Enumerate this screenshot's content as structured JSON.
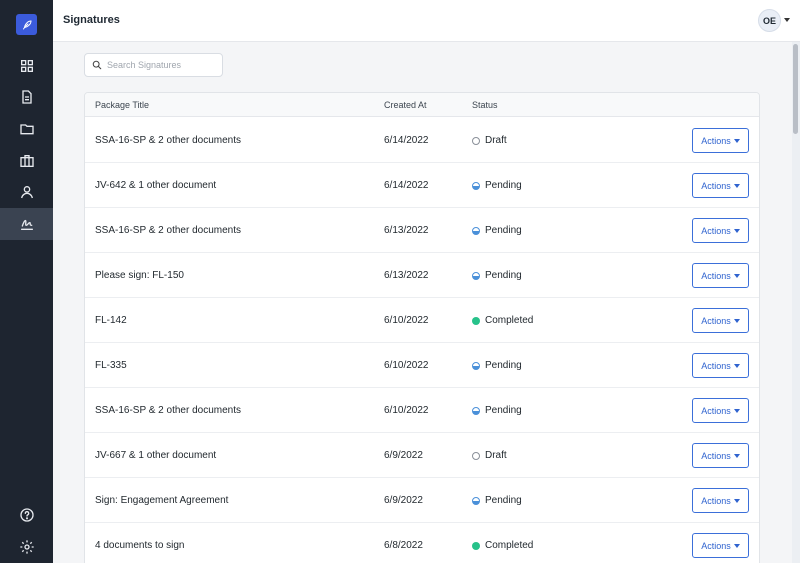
{
  "app": {
    "page_title": "Signatures"
  },
  "user": {
    "initials": "OE"
  },
  "search": {
    "placeholder": "Search Signatures",
    "value": ""
  },
  "sidebar": {
    "items": [
      {
        "icon": "grid-icon"
      },
      {
        "icon": "document-icon"
      },
      {
        "icon": "folder-icon"
      },
      {
        "icon": "briefcase-icon"
      },
      {
        "icon": "user-icon"
      },
      {
        "icon": "signature-icon",
        "active": true
      }
    ],
    "bottom": [
      {
        "icon": "help-icon"
      },
      {
        "icon": "settings-icon"
      }
    ]
  },
  "table": {
    "headers": {
      "title": "Package Title",
      "created": "Created At",
      "status": "Status"
    },
    "action_label": "Actions",
    "rows": [
      {
        "title": "SSA-16-SP & 2 other documents",
        "created": "6/14/2022",
        "status": "Draft",
        "kind": "draft"
      },
      {
        "title": "JV-642 & 1 other document",
        "created": "6/14/2022",
        "status": "Pending",
        "kind": "pending"
      },
      {
        "title": "SSA-16-SP & 2 other documents",
        "created": "6/13/2022",
        "status": "Pending",
        "kind": "pending"
      },
      {
        "title": "Please sign: FL-150",
        "created": "6/13/2022",
        "status": "Pending",
        "kind": "pending"
      },
      {
        "title": "FL-142",
        "created": "6/10/2022",
        "status": "Completed",
        "kind": "completed"
      },
      {
        "title": "FL-335",
        "created": "6/10/2022",
        "status": "Pending",
        "kind": "pending"
      },
      {
        "title": "SSA-16-SP & 2 other documents",
        "created": "6/10/2022",
        "status": "Pending",
        "kind": "pending"
      },
      {
        "title": "JV-667 & 1 other document",
        "created": "6/9/2022",
        "status": "Draft",
        "kind": "draft"
      },
      {
        "title": "Sign: Engagement Agreement",
        "created": "6/9/2022",
        "status": "Pending",
        "kind": "pending"
      },
      {
        "title": "4 documents to sign",
        "created": "6/8/2022",
        "status": "Completed",
        "kind": "completed"
      }
    ]
  },
  "colors": {
    "sidebar": "#1e2530",
    "accent": "#3b5bdb",
    "action": "#2f63cf",
    "completed": "#27c28a",
    "pending": "#4a90d9"
  }
}
